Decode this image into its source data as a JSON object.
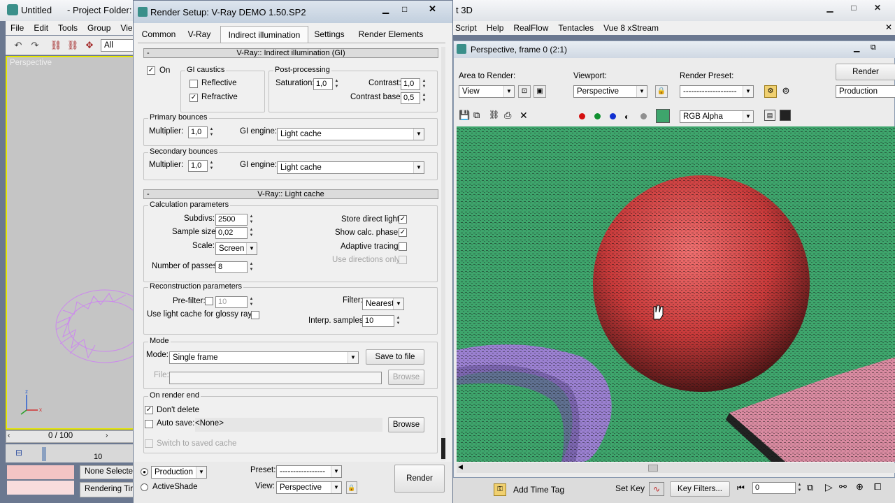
{
  "max": {
    "title": "Untitled",
    "project": "- Project Folder: C",
    "title_end": "t 3D",
    "menus": [
      "File",
      "Edit",
      "Tools",
      "Group",
      "Vie"
    ],
    "right_menus": [
      "Script",
      "Help",
      "RealFlow",
      "Tentacles",
      "Vue 8 xStream"
    ],
    "selection_filter": "All",
    "viewport_label": "Perspective",
    "timeline": "0 / 100",
    "frame_tick": "10",
    "status_none": "None Selecte",
    "status_rendering": "Rendering Tir",
    "add_time_tag": "Add Time Tag",
    "set_key": "Set Key",
    "key_filters": "Key Filters...",
    "frame_value": "0"
  },
  "render_setup": {
    "title": "Render Setup: V-Ray DEMO 1.50.SP2",
    "tabs": [
      "Common",
      "V-Ray",
      "Indirect illumination",
      "Settings",
      "Render Elements"
    ],
    "gi_rollout": "V-Ray:: Indirect illumination (GI)",
    "on": "On",
    "gi_caustics": "GI caustics",
    "reflective": "Reflective",
    "refractive": "Refractive",
    "post_processing": "Post-processing",
    "saturation_label": "Saturation:",
    "saturation": "1,0",
    "contrast_label": "Contrast:",
    "contrast": "1,0",
    "contrast_base_label": "Contrast base:",
    "contrast_base": "0,5",
    "primary_bounces": "Primary bounces",
    "multiplier_label": "Multiplier:",
    "primary_multiplier": "1,0",
    "gi_engine_label": "GI engine:",
    "primary_engine": "Light cache",
    "secondary_bounces": "Secondary bounces",
    "secondary_multiplier": "1,0",
    "secondary_engine": "Light cache",
    "lc_rollout": "V-Ray:: Light cache",
    "calc_params": "Calculation parameters",
    "subdivs_label": "Subdivs:",
    "subdivs": "2500",
    "sample_size_label": "Sample size:",
    "sample_size": "0,02",
    "scale_label": "Scale:",
    "scale": "Screen",
    "passes_label": "Number of passes:",
    "passes": "8",
    "store_direct": "Store direct light",
    "show_calc": "Show calc. phase",
    "adaptive": "Adaptive tracing",
    "use_directions": "Use directions only",
    "recon_params": "Reconstruction parameters",
    "prefilter_label": "Pre-filter:",
    "prefilter": "10",
    "glossy": "Use light cache for glossy rays",
    "filter_label": "Filter:",
    "filter": "Nearest",
    "interp_label": "Interp. samples:",
    "interp": "10",
    "mode_group": "Mode",
    "mode_label": "Mode:",
    "mode": "Single frame",
    "save_to_file": "Save to file",
    "file_label": "File:",
    "browse": "Browse",
    "on_render_end": "On render end",
    "dont_delete": "Don't delete",
    "auto_save": "Auto save:",
    "auto_save_value": "<None>",
    "switch_cache": "Switch to saved cache",
    "production": "Production",
    "activeshade": "ActiveShade",
    "preset_label": "Preset:",
    "preset": "-----------------",
    "view_label": "View:",
    "view": "Perspective",
    "render": "Render"
  },
  "frame": {
    "title": "Perspective, frame 0 (2:1)",
    "area_label": "Area to Render:",
    "area": "View",
    "viewport_label": "Viewport:",
    "viewport": "Perspective",
    "preset_label": "Render Preset:",
    "preset": "--------------------",
    "render": "Render",
    "production": "Production",
    "channel": "RGB Alpha",
    "colors": {
      "red": "#d41010",
      "green": "#109030",
      "blue": "#1030d0",
      "floor": "#3ea56c"
    }
  }
}
